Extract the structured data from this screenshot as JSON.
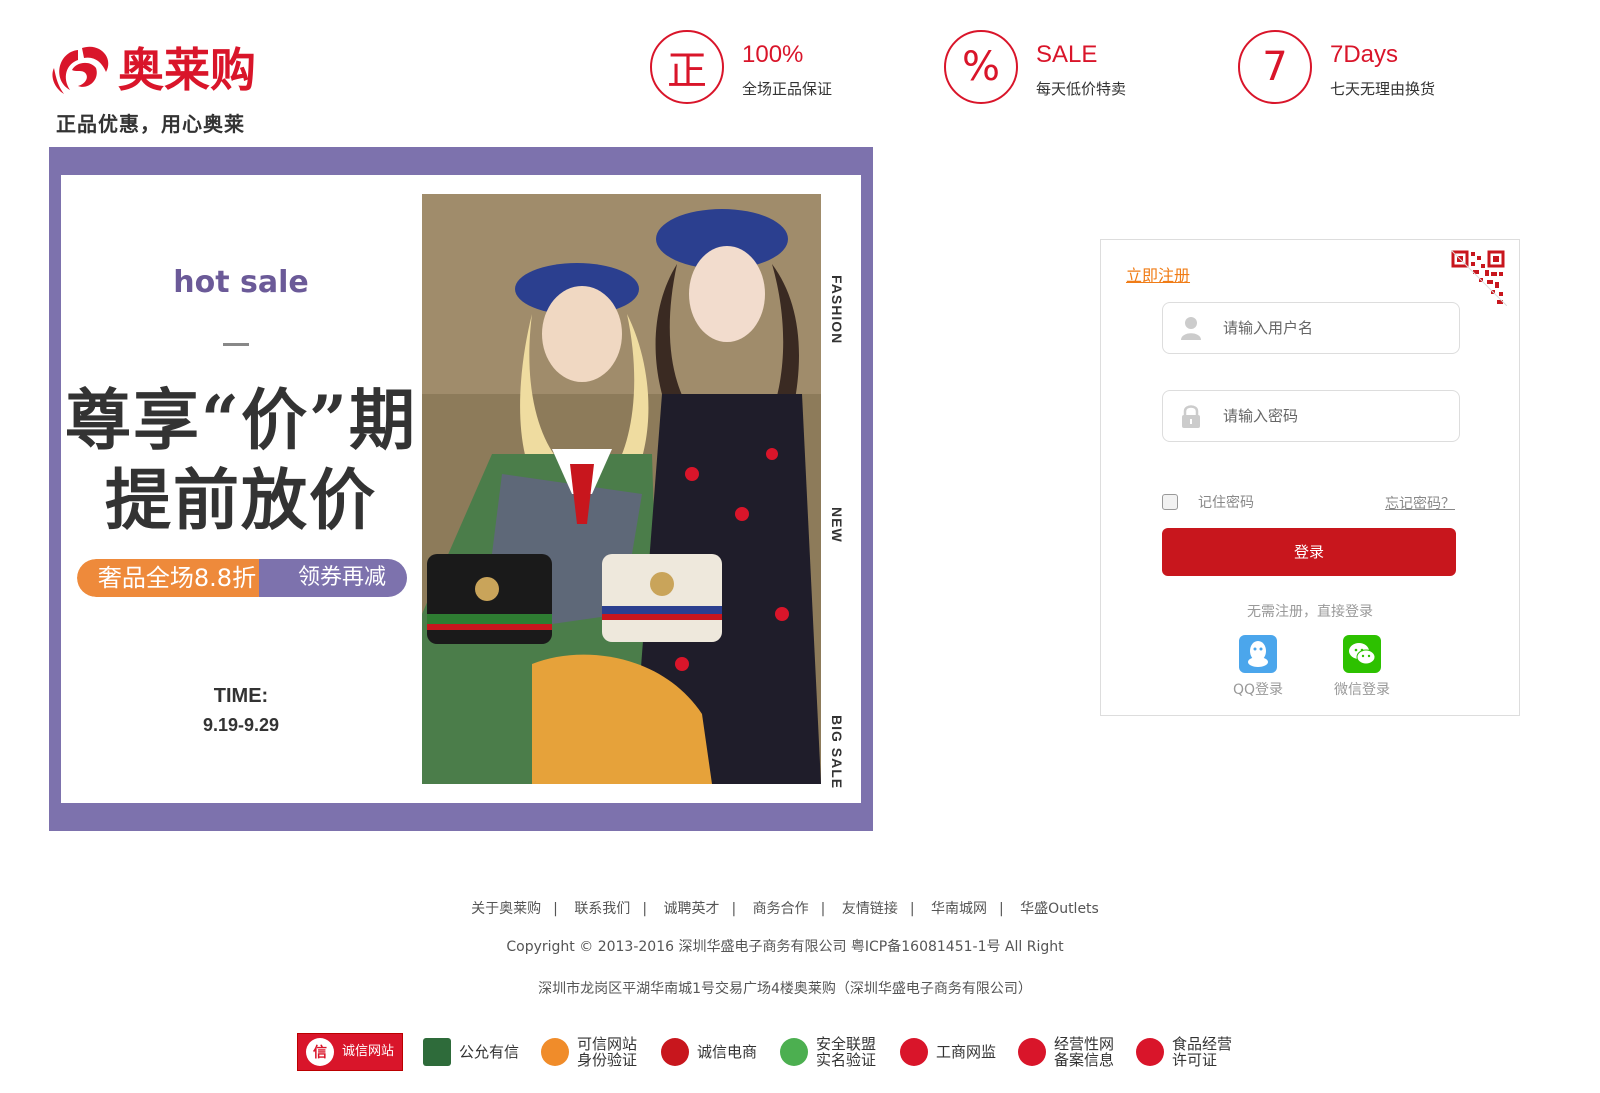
{
  "header": {
    "logo_text": "奥莱购",
    "slogan": "正品优惠，用心奥莱",
    "promises": [
      {
        "icon_char": "正",
        "title": "100%",
        "desc": "全场正品保证"
      },
      {
        "icon_char": "%",
        "title": "SALE",
        "desc": "每天低价特卖"
      },
      {
        "icon_char": "7",
        "title": "7Days",
        "desc": "七天无理由换货"
      }
    ]
  },
  "banner": {
    "hot": "hot sale",
    "headline_line1": "尊享“价”期",
    "headline_line2": "提前放价",
    "pill_left": "奢品全场8.8折",
    "pill_right": "领券再减",
    "time_label": "TIME:",
    "time_value": "9.19-9.29",
    "side_texts": [
      "FASHION",
      "NEW",
      "BIG SALE"
    ]
  },
  "login": {
    "register_link": "立即注册",
    "username_placeholder": "请输入用户名",
    "password_placeholder": "请输入密码",
    "remember_label": "记住密码",
    "forgot_link": "忘记密码？",
    "submit_label": "登录",
    "no_register_text": "无需注册，直接登录",
    "social": [
      {
        "label": "QQ登录",
        "icon": "qq-icon",
        "color": "#4ba6ec"
      },
      {
        "label": "微信登录",
        "icon": "wechat-icon",
        "color": "#2dc100"
      }
    ]
  },
  "footer": {
    "links": [
      "关于奥莱购",
      "联系我们",
      "诚聘英才",
      "商务合作",
      "友情链接",
      "华南城网",
      "华盛Outlets"
    ],
    "copyright": "Copyright © 2013-2016 深圳华盛电子商务有限公司 粤ICP备16081451-1号 All Right",
    "address": "深圳市龙岗区平湖华南城1号交易广场4楼奥莱购（深圳华盛电子商务有限公司）",
    "badges": [
      {
        "label": "诚信网站",
        "icon_char": "信"
      },
      {
        "label": "公允有信",
        "icon_char": ""
      },
      {
        "label": "可信网站身份验证",
        "line1": "可信网站",
        "line2": "身份验证",
        "icon_char": ""
      },
      {
        "label": "诚信电商",
        "icon_char": ""
      },
      {
        "label": "安全联盟实名验证",
        "line1": "安全联盟",
        "line2": "实名验证",
        "icon_char": ""
      },
      {
        "label": "工商网监",
        "icon_char": ""
      },
      {
        "label": "经营性网备案信息",
        "line1": "经营性网",
        "line2": "备案信息",
        "icon_char": ""
      },
      {
        "label": "食品经营许可证",
        "line1": "食品经营",
        "line2": "许可证",
        "icon_char": ""
      }
    ]
  },
  "colors": {
    "brand": "#d9152a",
    "accent": "#f07c16",
    "banner_purple": "#7d72ad",
    "button": "#c8161d"
  }
}
